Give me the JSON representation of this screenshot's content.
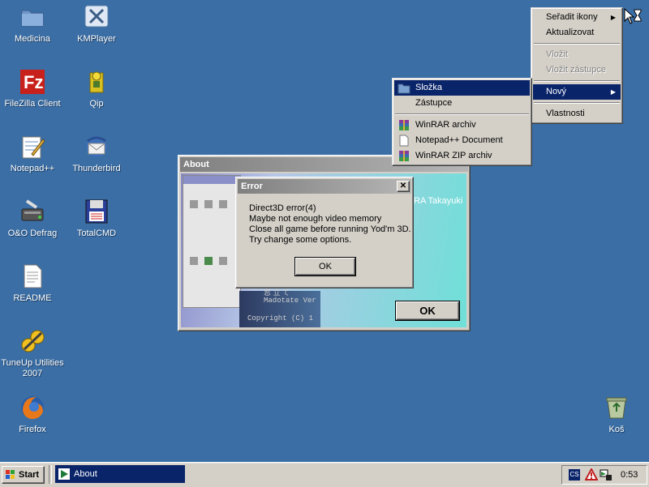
{
  "desktop": {
    "icons": [
      {
        "label": "Medicina"
      },
      {
        "label": "KMPlayer"
      },
      {
        "label": "FileZilla Client"
      },
      {
        "label": "Qip"
      },
      {
        "label": "Notepad++"
      },
      {
        "label": "Thunderbird"
      },
      {
        "label": "O&O Defrag"
      },
      {
        "label": "TotalCMD"
      },
      {
        "label": "README"
      },
      {
        "label": "TuneUp Utilities 2007"
      },
      {
        "label": "Firefox"
      },
      {
        "label": "Koš"
      }
    ]
  },
  "context_menu": {
    "items": [
      "Seřadit ikony",
      "Aktualizovat",
      "Vložit",
      "Vložit zástupce",
      "Nový",
      "Vlastnosti"
    ]
  },
  "submenu": {
    "items": [
      "Složka",
      "Zástupce",
      "WinRAR archiv",
      "Notepad++ Document",
      "WinRAR ZIP archiv"
    ]
  },
  "about_window": {
    "title": "About",
    "author_fragment": "RA Takayuki",
    "line1": "窓 立 て",
    "line2": "Madotate Ver",
    "line3": "Copyright (C) 1",
    "ok_label": "OK"
  },
  "error_dialog": {
    "title": "Error",
    "close": "✕",
    "lines": [
      "Direct3D error(4)",
      "Maybe not enough video memory",
      "Close all game before running Yod'm 3D.",
      "Try change some options."
    ],
    "ok_label": "OK"
  },
  "taskbar": {
    "start_label": "Start",
    "task_label": "About",
    "clock": "0:53",
    "tray_text": "CS"
  }
}
